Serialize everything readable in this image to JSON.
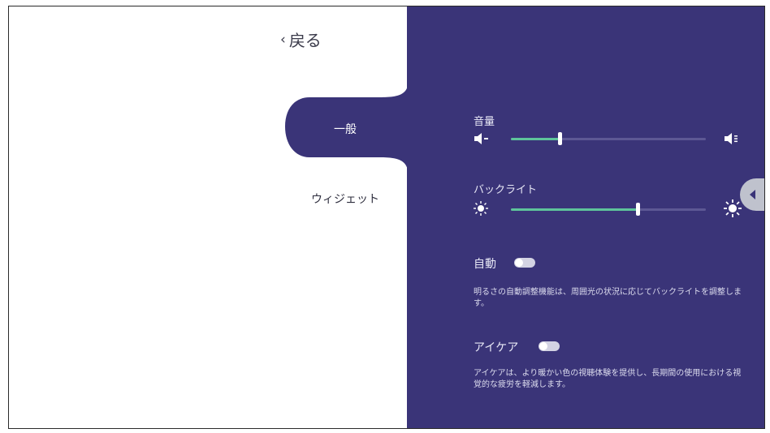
{
  "header": {
    "back_label": "戻る",
    "back_icon": "chevron-left-icon"
  },
  "nav": {
    "items": [
      {
        "label": "一般",
        "active": true
      },
      {
        "label": "ウィジェット",
        "active": false
      }
    ]
  },
  "settings": {
    "volume": {
      "label": "音量",
      "level_percent": 25,
      "min_icon": "speaker-mute-icon",
      "max_icon": "speaker-loud-icon"
    },
    "backlight": {
      "label": "バックライト",
      "level_percent": 65,
      "min_icon": "sun-dim-icon",
      "max_icon": "sun-bright-icon"
    },
    "auto": {
      "label": "自動",
      "enabled": false,
      "description": "明るさの自動調整機能は、周囲光の状況に応じてバックライトを調整します。"
    },
    "eyecare": {
      "label": "アイケア",
      "enabled": false,
      "description": "アイケアは、より暖かい色の視聴体験を提供し、長期間の使用における視覚的な疲労を軽減します。"
    }
  },
  "colors": {
    "panel": "#3a3478",
    "slider_fill": "#5ec49b",
    "track": "#5d5894"
  }
}
